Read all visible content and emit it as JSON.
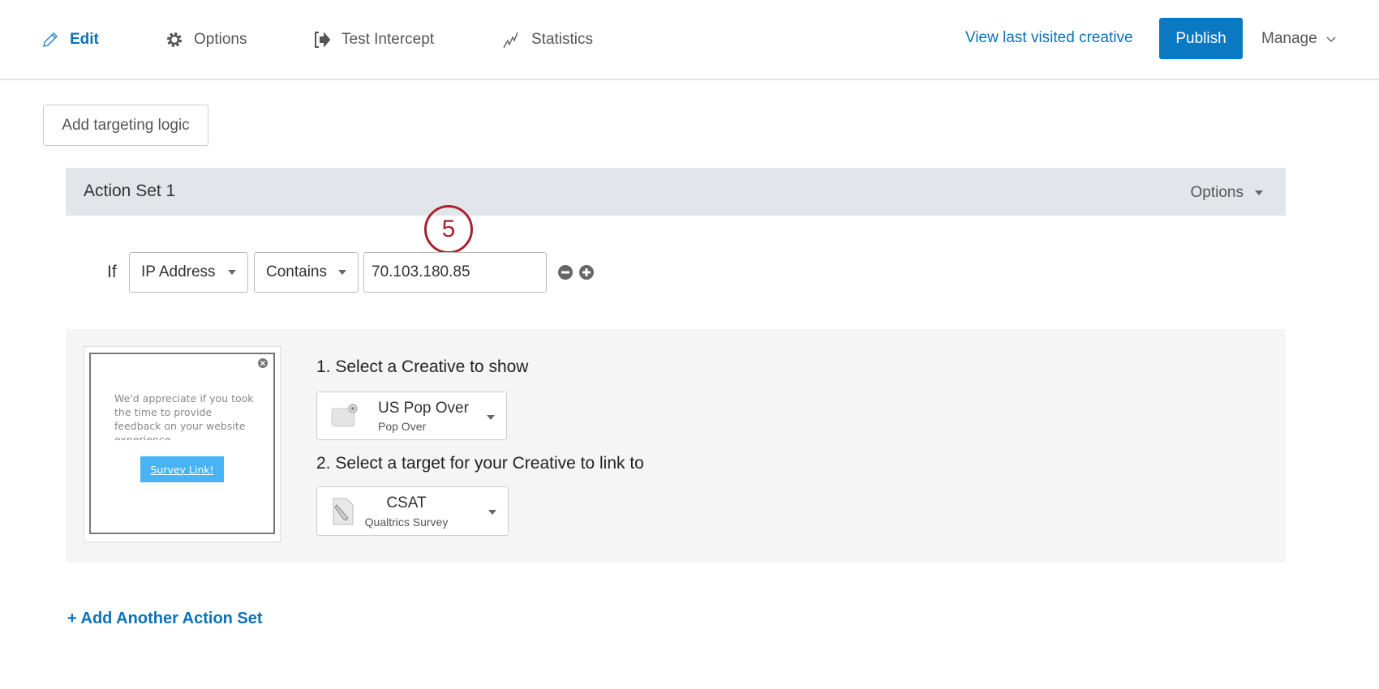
{
  "nav": {
    "edit": "Edit",
    "options": "Options",
    "test_intercept": "Test Intercept",
    "statistics": "Statistics",
    "view_last": "View last visited creative",
    "publish": "Publish",
    "manage": "Manage"
  },
  "add_targeting": "Add targeting logic",
  "action_set": {
    "title": "Action Set 1",
    "options": "Options",
    "step_badge": "5",
    "condition": {
      "if": "If",
      "field": "IP Address",
      "operator": "Contains",
      "value": "70.103.180.85"
    },
    "preview": {
      "message": "We'd appreciate if you took the time to provide feedback on your website experience.",
      "link": "Survey Link!"
    },
    "step1": "1. Select a Creative to show",
    "creative": {
      "name": "US Pop Over",
      "type": "Pop Over"
    },
    "step2": "2. Select a target for your Creative to link to",
    "target": {
      "name": "CSAT",
      "type": "Qualtrics Survey"
    }
  },
  "add_action_set": "+ Add Another Action Set",
  "colors": {
    "accent": "#0b72b9",
    "publish": "#0b78c2",
    "badge": "#a8232e",
    "panel": "#f5f5f5",
    "header": "#e2e6ea"
  }
}
